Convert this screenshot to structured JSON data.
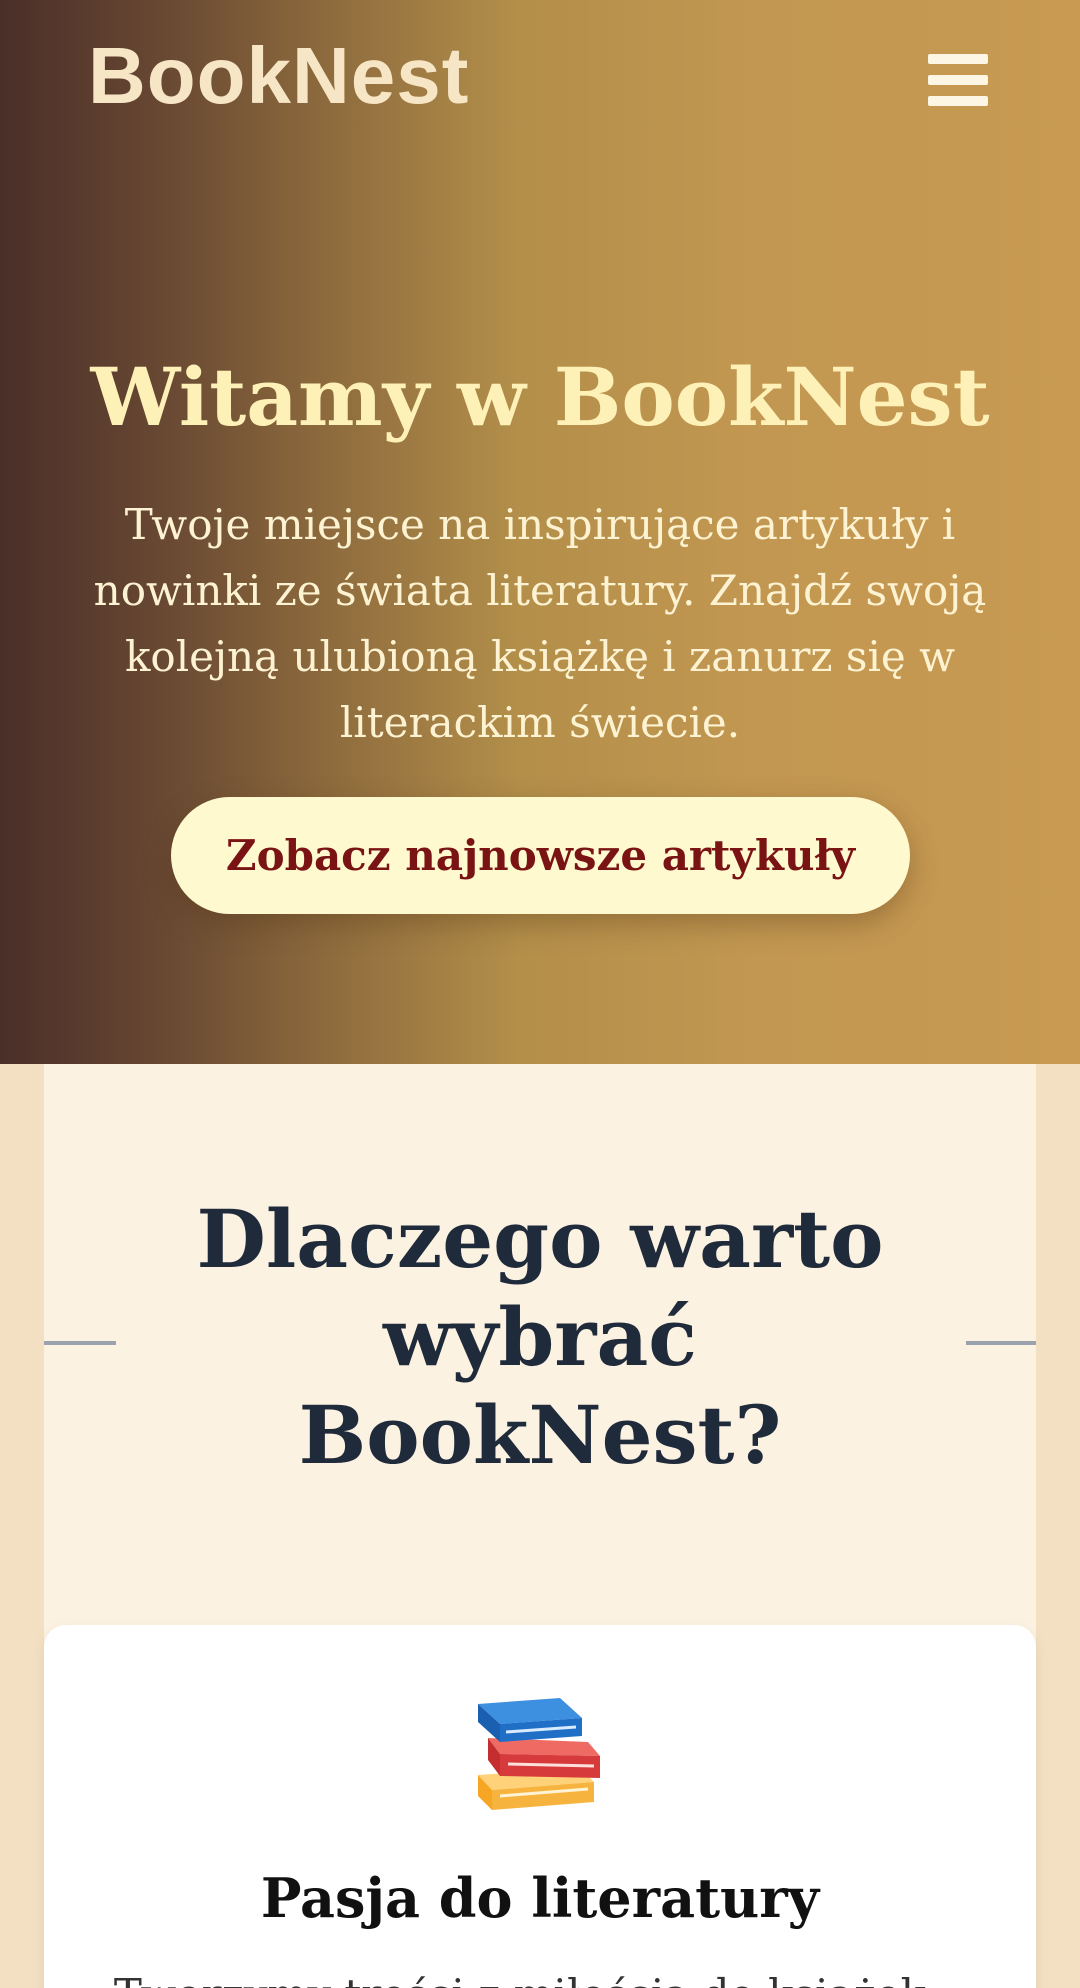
{
  "header": {
    "logo": "BookNest",
    "menu_icon": "hamburger-menu-icon"
  },
  "hero": {
    "title": "Witamy w BookNest",
    "text": "Twoje miejsce na inspirujące artykuły i nowinki ze świata literatury. Znajdź swoją kolejną ulubioną książkę i zanurz się w literackim świecie.",
    "cta_label": "Zobacz najnowsze artykuły"
  },
  "why": {
    "title": "Dlaczego warto wybrać BookNest?",
    "cards": [
      {
        "icon": "books-icon",
        "title": "Pasja do literatury",
        "text": "Tworzymy treści z miłością do książek..."
      }
    ]
  },
  "colors": {
    "hero_gradient_start": "#4a2e29",
    "hero_gradient_end": "#c89a52",
    "cta_background": "#fef9ce",
    "cta_text": "#7a1414",
    "section_background": "#fbf2e1",
    "page_background": "#f3dfc1",
    "heading_dark": "#1f2a3b"
  }
}
